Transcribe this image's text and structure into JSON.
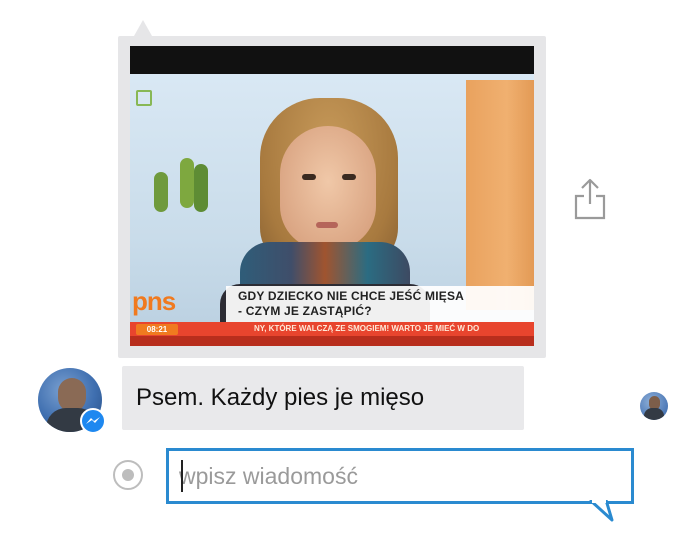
{
  "image_message": {
    "tv_caption_line1": "GDY DZIECKO NIE CHCE JEŚĆ MIĘSA",
    "tv_caption_line2": "- CZYM JE ZASTĄPIĆ?",
    "tv_ticker": "NY, KTÓRE WALCZĄ ZE SMOGIEM! WARTO JE MIEĆ W DO",
    "tv_time": "08:21",
    "tv_logo": "pns"
  },
  "text_message": {
    "label": "Psem. Każdy pies je mięso"
  },
  "composer": {
    "placeholder": "wpisz wiadomość"
  },
  "colors": {
    "input_border": "#2a8ad0",
    "messenger_badge": "#1e88f0",
    "bubble": "#e9e9eb"
  },
  "icons": {
    "share": "share-icon",
    "messenger": "messenger-icon",
    "emoji": "radio-icon"
  }
}
